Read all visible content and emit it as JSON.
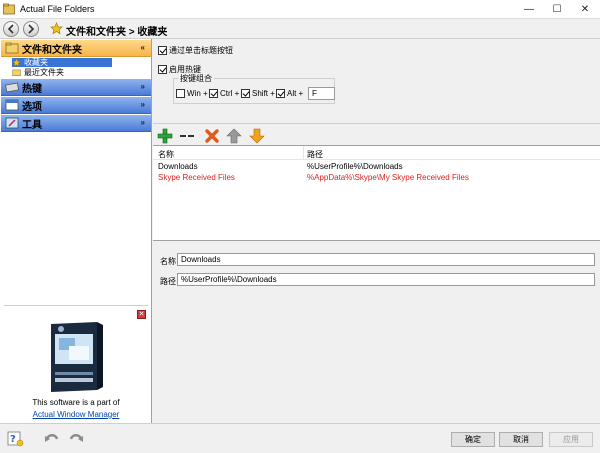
{
  "window": {
    "title": "Actual File Folders",
    "controls": {
      "minimize": "—",
      "maximize": "☐",
      "close": "✕"
    }
  },
  "nav": {
    "breadcrumb": "文件和文件夹 > 收藏夹"
  },
  "sidebar": {
    "sections": [
      {
        "label": "文件和文件夹",
        "chevron": "«",
        "items": [
          "收藏夹",
          "最近文件夹"
        ]
      },
      {
        "label": "热键",
        "chevron": "»"
      },
      {
        "label": "选项",
        "chevron": "»"
      },
      {
        "label": "工具",
        "chevron": "»"
      }
    ],
    "promo": {
      "close": "✕",
      "line1": "This software is a part of",
      "link": "Actual Window Manager"
    }
  },
  "settings": {
    "cb_title_click": "通过单击标题按钮",
    "cb_enable_hotkey": "启用热键",
    "hotkey_group": "按键组合",
    "keys": [
      {
        "label": "Win +",
        "checked": false
      },
      {
        "label": "Ctrl +",
        "checked": true
      },
      {
        "label": "Shift +",
        "checked": true
      },
      {
        "label": "Alt +",
        "checked": true
      }
    ],
    "key_value": "F"
  },
  "list": {
    "columns": [
      "名称",
      "路径"
    ],
    "rows": [
      {
        "name": "Downloads",
        "path": "%UserProfile%\\Downloads",
        "color": "#000000"
      },
      {
        "name": "Skype Received Files",
        "path": "%AppData%\\Skype\\My Skype Received Files",
        "color": "#e02020"
      }
    ]
  },
  "details": {
    "name_label": "名称",
    "name_value": "Downloads",
    "path_label": "路径",
    "path_value": "%UserProfile%\\Downloads"
  },
  "buttons": {
    "ok": "确定",
    "cancel": "取消",
    "apply": "应用"
  }
}
